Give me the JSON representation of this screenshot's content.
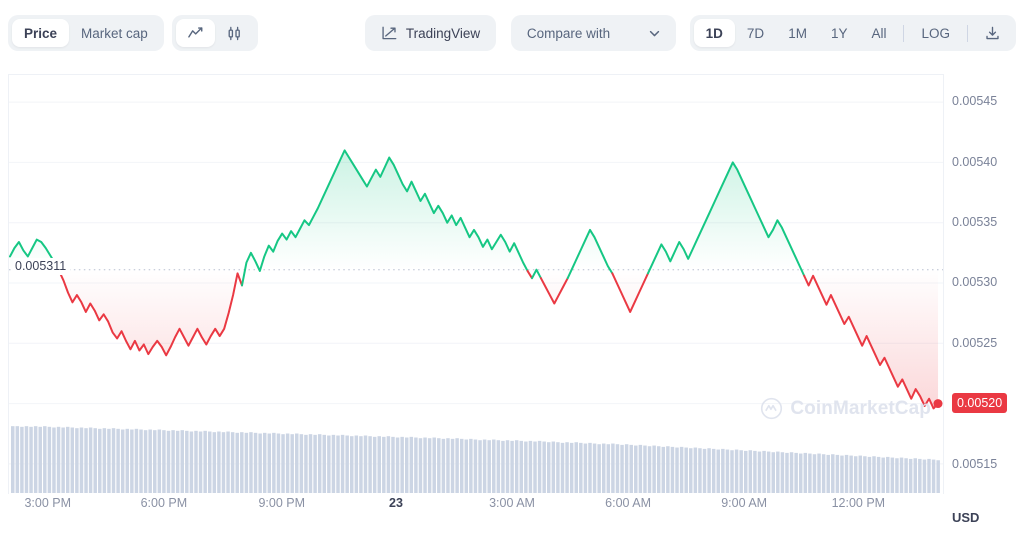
{
  "toolbar": {
    "metric_tabs": [
      {
        "label": "Price",
        "active": true
      },
      {
        "label": "Market cap",
        "active": false
      }
    ],
    "chart_type_tabs": [
      {
        "icon": "line-chart-icon",
        "active": true
      },
      {
        "icon": "candlestick-icon",
        "active": false
      }
    ],
    "tradingview_label": "TradingView",
    "compare_label": "Compare with",
    "ranges": [
      {
        "label": "1D",
        "active": true
      },
      {
        "label": "7D",
        "active": false
      },
      {
        "label": "1M",
        "active": false
      },
      {
        "label": "1Y",
        "active": false
      },
      {
        "label": "All",
        "active": false
      }
    ],
    "log_label": "LOG",
    "download_icon": "download-icon"
  },
  "watermark": {
    "text": "CoinMarketCap",
    "logo": "coinmarketcap-logo-icon"
  },
  "currency_label": "USD",
  "start_price_label": "0.005311",
  "last_price_label": "0.00520",
  "chart_data": {
    "type": "line",
    "title": "",
    "xlabel": "",
    "ylabel": "USD",
    "grid": true,
    "legend": false,
    "ylim": [
      0.005125,
      0.0054725
    ],
    "y_ticks": [
      "0.00545",
      "0.00540",
      "0.00535",
      "0.00530",
      "0.00525",
      "0.00520",
      "0.00515"
    ],
    "y_tick_values": [
      0.00545,
      0.0054,
      0.00535,
      0.0053,
      0.00525,
      0.0052,
      0.00515
    ],
    "x_ticks": [
      "3:00 PM",
      "6:00 PM",
      "9:00 PM",
      "23",
      "3:00 AM",
      "6:00 AM",
      "9:00 AM",
      "12:00 PM"
    ],
    "x_tick_positions": [
      0.0425,
      0.1665,
      0.2925,
      0.4145,
      0.5385,
      0.6625,
      0.7865,
      0.9085
    ],
    "x_tick_bold_index": 3,
    "reference_price": 0.005311,
    "color_up": "#16c784",
    "color_down": "#ea3943",
    "last_marker_color": "#ea3943",
    "series": [
      {
        "name": "Price",
        "values": [
          0.005322,
          0.005329,
          0.005334,
          0.005327,
          0.005322,
          0.005329,
          0.005336,
          0.005334,
          0.005329,
          0.005323,
          0.005317,
          0.00531,
          0.005302,
          0.005292,
          0.005284,
          0.00529,
          0.005284,
          0.005276,
          0.005283,
          0.005277,
          0.005269,
          0.005274,
          0.005268,
          0.005259,
          0.005254,
          0.00526,
          0.005252,
          0.005245,
          0.005252,
          0.005244,
          0.005249,
          0.005241,
          0.005247,
          0.005252,
          0.005247,
          0.00524,
          0.005247,
          0.005255,
          0.005262,
          0.005255,
          0.005248,
          0.005255,
          0.005262,
          0.005255,
          0.005249,
          0.005256,
          0.005262,
          0.005256,
          0.005262,
          0.005275,
          0.00529,
          0.005308,
          0.005298,
          0.005317,
          0.005325,
          0.005318,
          0.00531,
          0.005322,
          0.005331,
          0.005326,
          0.005335,
          0.005341,
          0.005336,
          0.005343,
          0.005338,
          0.005345,
          0.005352,
          0.005348,
          0.005355,
          0.005362,
          0.00537,
          0.005378,
          0.005386,
          0.005394,
          0.005402,
          0.00541,
          0.005404,
          0.005398,
          0.005392,
          0.005386,
          0.00538,
          0.005387,
          0.005394,
          0.005388,
          0.005396,
          0.005404,
          0.005398,
          0.00539,
          0.005382,
          0.005376,
          0.005384,
          0.005376,
          0.005368,
          0.005374,
          0.005366,
          0.005358,
          0.005364,
          0.005358,
          0.00535,
          0.005356,
          0.005348,
          0.005354,
          0.005346,
          0.005338,
          0.005344,
          0.005338,
          0.00533,
          0.005336,
          0.005328,
          0.005334,
          0.00534,
          0.005334,
          0.005326,
          0.005333,
          0.005325,
          0.005317,
          0.00531,
          0.005304,
          0.005311,
          0.005304,
          0.005297,
          0.00529,
          0.005283,
          0.00529,
          0.005297,
          0.005304,
          0.005312,
          0.00532,
          0.005328,
          0.005336,
          0.005344,
          0.005338,
          0.00533,
          0.005322,
          0.005314,
          0.005308,
          0.0053,
          0.005292,
          0.005284,
          0.005276,
          0.005284,
          0.005292,
          0.0053,
          0.005308,
          0.005316,
          0.005324,
          0.005332,
          0.005326,
          0.005318,
          0.005326,
          0.005334,
          0.005328,
          0.00532,
          0.005328,
          0.005336,
          0.005344,
          0.005352,
          0.00536,
          0.005368,
          0.005376,
          0.005384,
          0.005392,
          0.0054,
          0.005394,
          0.005386,
          0.005378,
          0.00537,
          0.005362,
          0.005354,
          0.005346,
          0.005338,
          0.005344,
          0.005352,
          0.005346,
          0.005338,
          0.00533,
          0.005322,
          0.005314,
          0.005306,
          0.005298,
          0.005306,
          0.005298,
          0.00529,
          0.005282,
          0.00529,
          0.005282,
          0.005274,
          0.005266,
          0.005272,
          0.005264,
          0.005256,
          0.005248,
          0.005256,
          0.005248,
          0.00524,
          0.005232,
          0.005238,
          0.00523,
          0.005222,
          0.005214,
          0.00522,
          0.005212,
          0.005204,
          0.005212,
          0.005206,
          0.005198,
          0.005204,
          0.005196,
          0.0052
        ]
      }
    ],
    "volume": {
      "name": "Volume",
      "normalized_values": [
        1.0,
        1.0,
        0.99,
        1.0,
        0.99,
        1.0,
        0.99,
        1.0,
        0.99,
        0.98,
        0.99,
        0.98,
        0.99,
        0.98,
        0.97,
        0.98,
        0.97,
        0.98,
        0.97,
        0.96,
        0.97,
        0.96,
        0.97,
        0.96,
        0.95,
        0.96,
        0.95,
        0.96,
        0.95,
        0.94,
        0.95,
        0.94,
        0.95,
        0.94,
        0.93,
        0.94,
        0.93,
        0.94,
        0.93,
        0.92,
        0.93,
        0.92,
        0.93,
        0.92,
        0.91,
        0.92,
        0.91,
        0.92,
        0.91,
        0.9,
        0.91,
        0.9,
        0.91,
        0.9,
        0.89,
        0.9,
        0.89,
        0.9,
        0.89,
        0.88,
        0.89,
        0.88,
        0.89,
        0.88,
        0.87,
        0.88,
        0.87,
        0.88,
        0.87,
        0.86,
        0.87,
        0.86,
        0.87,
        0.86,
        0.85,
        0.86,
        0.85,
        0.86,
        0.85,
        0.84,
        0.85,
        0.84,
        0.85,
        0.84,
        0.83,
        0.84,
        0.83,
        0.84,
        0.83,
        0.82,
        0.83,
        0.82,
        0.83,
        0.82,
        0.81,
        0.82,
        0.81,
        0.82,
        0.81,
        0.8,
        0.81,
        0.8,
        0.79,
        0.8,
        0.79,
        0.8,
        0.79,
        0.78,
        0.79,
        0.78,
        0.79,
        0.78,
        0.77,
        0.78,
        0.77,
        0.78,
        0.77,
        0.76,
        0.77,
        0.76,
        0.75,
        0.76,
        0.75,
        0.76,
        0.75,
        0.74,
        0.75,
        0.74,
        0.73,
        0.74,
        0.73,
        0.74,
        0.73,
        0.72,
        0.73,
        0.72,
        0.71,
        0.72,
        0.71,
        0.7,
        0.71,
        0.7,
        0.69,
        0.7,
        0.69,
        0.68,
        0.69,
        0.68,
        0.67,
        0.68,
        0.67,
        0.66,
        0.67,
        0.66,
        0.65,
        0.66,
        0.65,
        0.64,
        0.65,
        0.64,
        0.63,
        0.64,
        0.63,
        0.62,
        0.63,
        0.62,
        0.61,
        0.62,
        0.61,
        0.6,
        0.61,
        0.6,
        0.59,
        0.6,
        0.59,
        0.58,
        0.59,
        0.58,
        0.57,
        0.58,
        0.57,
        0.56,
        0.57,
        0.56,
        0.55,
        0.56,
        0.55,
        0.54,
        0.55,
        0.54,
        0.53,
        0.54,
        0.53,
        0.52,
        0.53,
        0.52,
        0.51,
        0.52,
        0.51,
        0.5,
        0.51,
        0.5,
        0.49
      ],
      "bar_color": "#ccd5e4"
    }
  }
}
